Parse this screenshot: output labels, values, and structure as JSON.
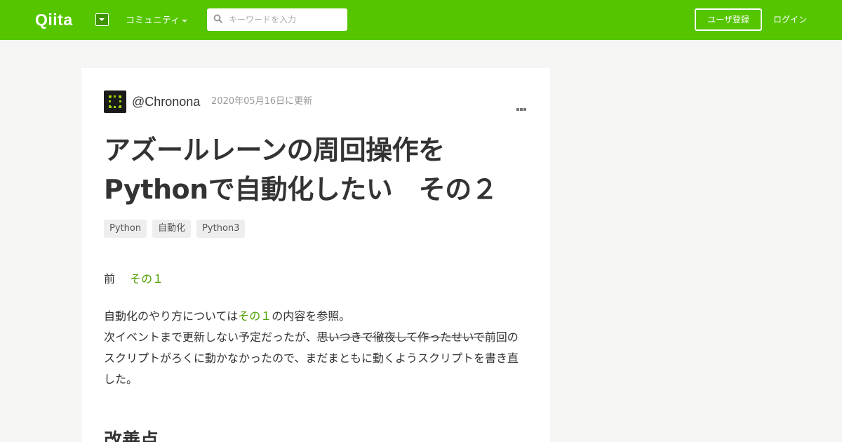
{
  "header": {
    "logo": "Qiita",
    "community_label": "コミュニティ",
    "search_placeholder": "キーワードを入力",
    "signup_label": "ユーザ登録",
    "login_label": "ログイン",
    "brand_color": "#55c500"
  },
  "article": {
    "author": "@Chronona",
    "updated": "2020年05月16日に更新",
    "title_line1": "アズールレーンの周回操作を",
    "title_line2": "Pythonで自動化したい　その２",
    "tags": [
      "Python",
      "自動化",
      "Python3"
    ],
    "prev_label": "前",
    "prev_link": "その１",
    "para_part1": "自動化のやり方については",
    "para_link": "その１",
    "para_part2": "の内容を参照。",
    "para_line2a": "次イベントまで更新しない予定だったが、",
    "para_strike": "思いつきで徹夜して作ったせいで",
    "para_line2b": "前回の",
    "para_line3": "スクリプトがろくに動かなかったので、まだまともに動くようスクリプトを書き直",
    "para_line4": "した。",
    "heading": "改善点"
  }
}
